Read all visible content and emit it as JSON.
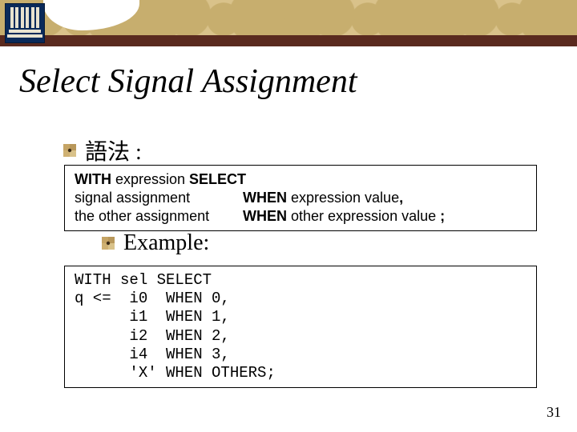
{
  "title": "Select Signal Assignment",
  "bullets": {
    "syntax_label": "語法 :",
    "example_label": "Example:"
  },
  "syntax": {
    "line1_left": "WITH",
    "line1_mid": " expression ",
    "line1_right": "SELECT",
    "line2_col1": "signal assignment",
    "line2_col2a": "WHEN",
    "line2_col2b": " expression value",
    "line2_col2c": ",",
    "line3_col1": "the other assignment",
    "line3_col2a": "WHEN",
    "line3_col2b": " other expression value ",
    "line3_col2c": ";"
  },
  "example_code": "WITH sel SELECT\nq <=  i0  WHEN 0,\n      i1  WHEN 1,\n      i2  WHEN 2,\n      i4  WHEN 3,\n      'X' WHEN OTHERS;",
  "page_number": "31"
}
